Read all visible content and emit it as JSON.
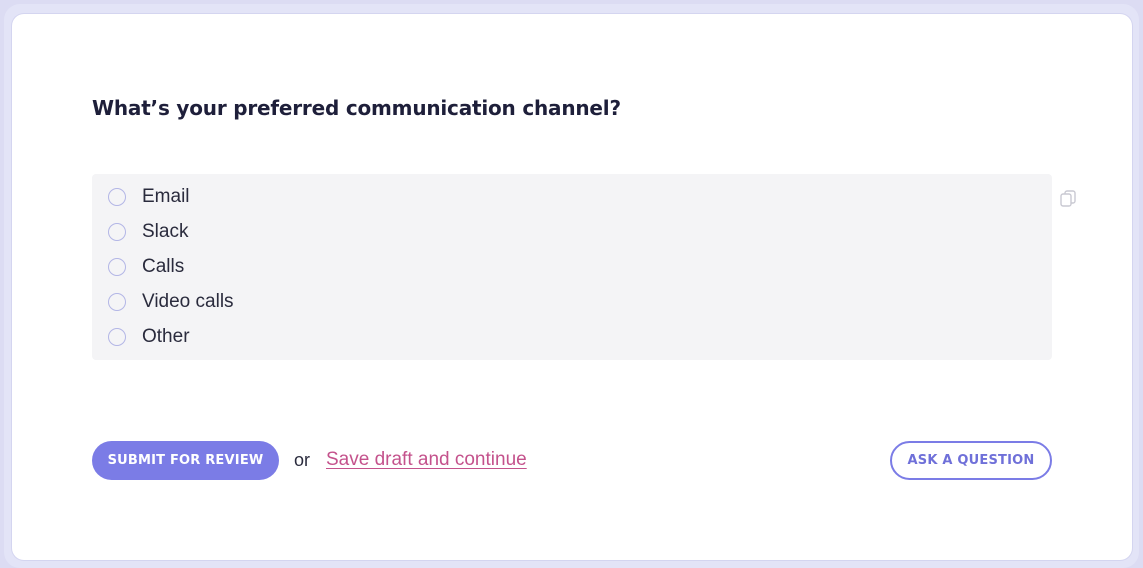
{
  "question": {
    "title": "What’s your preferred communication channel?"
  },
  "options": [
    {
      "label": "Email"
    },
    {
      "label": "Slack"
    },
    {
      "label": "Calls"
    },
    {
      "label": "Video calls"
    },
    {
      "label": "Other"
    }
  ],
  "icons": {
    "copy": "copy-icon"
  },
  "actions": {
    "submit_label": "SUBMIT FOR REVIEW",
    "or_text": "or",
    "save_draft_label": "Save draft and continue",
    "ask_label": "ASK A QUESTION"
  },
  "colors": {
    "accent": "#7b7ce6",
    "link": "#c4528c",
    "options_bg": "#f4f4f6"
  }
}
